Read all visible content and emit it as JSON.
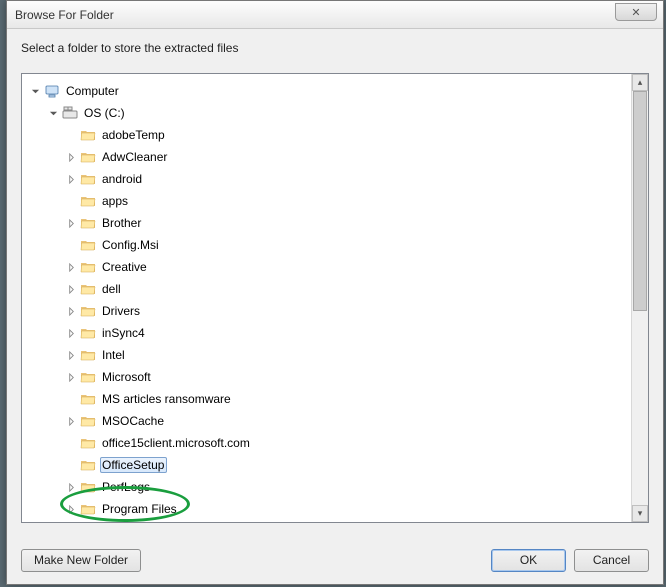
{
  "title": "Browse For Folder",
  "instruction": "Select a folder to store the extracted files",
  "tree": {
    "root": {
      "label": "Computer",
      "expanded": true,
      "drive": {
        "label": "OS (C:)",
        "expanded": true,
        "folders": [
          {
            "label": "adobeTemp",
            "expandable": false
          },
          {
            "label": "AdwCleaner",
            "expandable": true
          },
          {
            "label": "android",
            "expandable": true
          },
          {
            "label": "apps",
            "expandable": false
          },
          {
            "label": "Brother",
            "expandable": true
          },
          {
            "label": "Config.Msi",
            "expandable": false
          },
          {
            "label": "Creative",
            "expandable": true
          },
          {
            "label": "dell",
            "expandable": true
          },
          {
            "label": "Drivers",
            "expandable": true
          },
          {
            "label": "inSync4",
            "expandable": true
          },
          {
            "label": "Intel",
            "expandable": true
          },
          {
            "label": "Microsoft",
            "expandable": true
          },
          {
            "label": "MS articles ransomware",
            "expandable": false
          },
          {
            "label": "MSOCache",
            "expandable": true
          },
          {
            "label": "office15client.microsoft.com",
            "expandable": false
          },
          {
            "label": "OfficeSetup",
            "expandable": false,
            "selected": true
          },
          {
            "label": "PerfLogs",
            "expandable": true
          },
          {
            "label": "Program Files",
            "expandable": true
          }
        ]
      }
    }
  },
  "buttons": {
    "make_new_folder": "Make New Folder",
    "ok": "OK",
    "cancel": "Cancel"
  },
  "annotation": {
    "type": "ellipse",
    "color": "#1a9e3e",
    "target": "OfficeSetup"
  }
}
